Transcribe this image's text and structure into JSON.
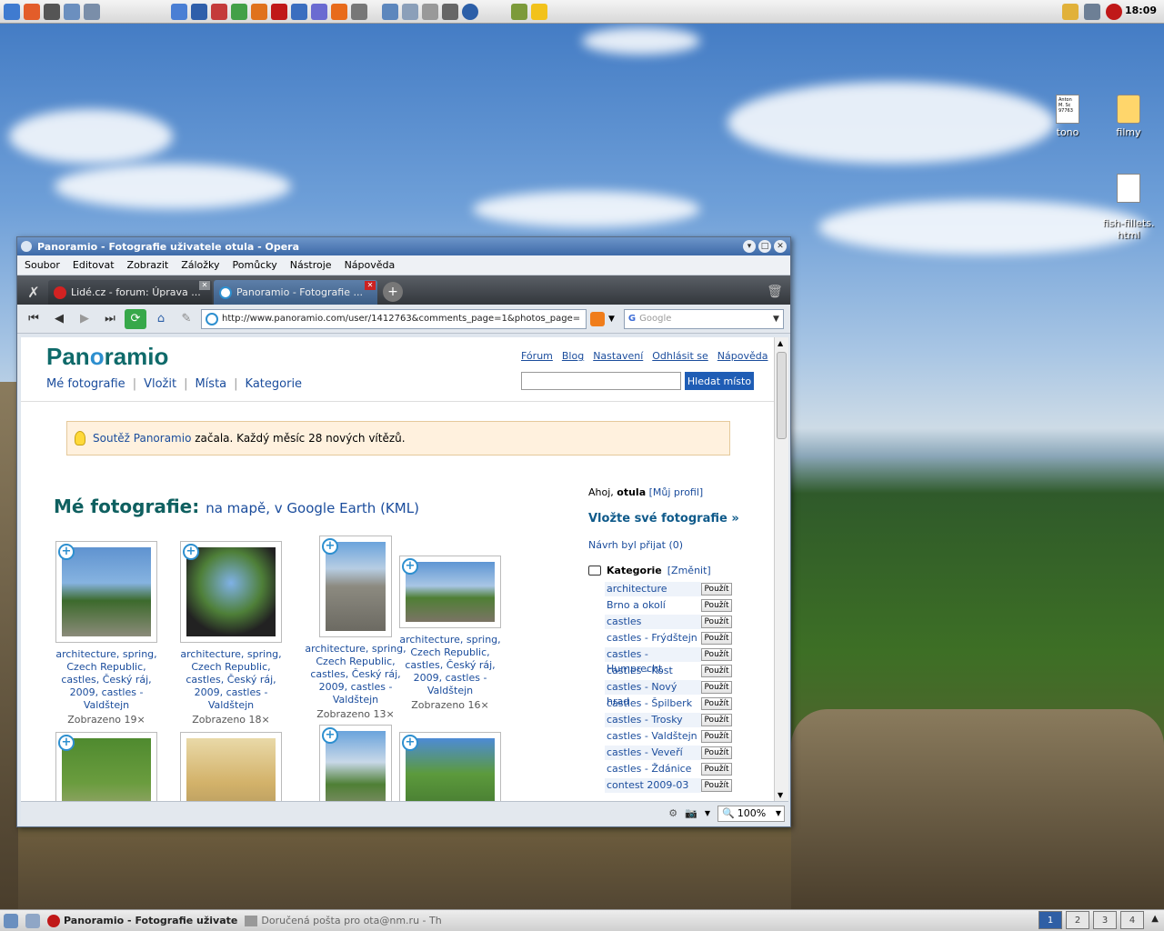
{
  "desktop": {
    "clock": "18:09",
    "icons": [
      {
        "label": "tono",
        "thumb_text": "Anton M. Sc 97763"
      },
      {
        "label": "filmy"
      },
      {
        "label": "fish-fillets.\nhtml"
      }
    ]
  },
  "window": {
    "title": "Panoramio - Fotografie uživatele otula - Opera",
    "menu": [
      "Soubor",
      "Editovat",
      "Zobrazit",
      "Záložky",
      "Pomůcky",
      "Nástroje",
      "Nápověda"
    ],
    "tabs": [
      {
        "label": "Lidé.cz - forum: Úprava ...",
        "active": false
      },
      {
        "label": "Panoramio - Fotografie ...",
        "active": true
      }
    ],
    "address": "http://www.panoramio.com/user/1412763&comments_page=1&photos_page=",
    "search_placeholder": "Google",
    "zoom": "100%"
  },
  "page": {
    "logo": {
      "pre": "Pan",
      "o": "o",
      "post": "ramio"
    },
    "nav": [
      "Mé fotografie",
      "Vložit",
      "Místa",
      "Kategorie"
    ],
    "toplinks": [
      "Fórum",
      "Blog",
      "Nastavení",
      "Odhlásit se",
      "Nápověda"
    ],
    "search_button": "Hledat místo",
    "notice": {
      "link": "Soutěž Panoramio",
      "text": " začala. Každý měsíc 28 nových vítězů."
    },
    "section_title": "Mé fotografie:",
    "section_links": {
      "map": "na mapě",
      "sep": ", ",
      "earth": "v Google Earth (KML)"
    },
    "photos": [
      {
        "tags": "architecture, spring, Czech Republic, castles, Český ráj, 2009, castles - Valdštejn",
        "views": "Zobrazeno 19×"
      },
      {
        "tags": "architecture, spring, Czech Republic, castles, Český ráj, 2009, castles - Valdštejn",
        "views": "Zobrazeno 18×"
      },
      {
        "tags": "architecture, spring, Czech Republic, castles, Český ráj, 2009, castles - Valdštejn",
        "views": "Zobrazeno 13×"
      },
      {
        "tags": "architecture, spring, Czech Republic, castles, Český ráj, 2009, castles - Valdštejn",
        "views": "Zobrazeno 16×"
      }
    ],
    "sidebar": {
      "hello": "Ahoj,",
      "user": "otula",
      "profile": "[Můj profil]",
      "upload": "Vložte své fotografie »",
      "accepted": "Návrh byl přijat (0)",
      "categories_title": "Kategorie",
      "categories_change": "[Změnit]",
      "use_label": "Použít",
      "categories": [
        "architecture",
        "Brno a okolí",
        "castles",
        "castles - Frýdštejn",
        "castles - Humprecht",
        "castles - Kost",
        "castles - Nový hrad",
        "castles - Špilberk",
        "castles - Trosky",
        "castles - Valdštejn",
        "castles - Veveří",
        "castles - Ždánice",
        "contest 2009-03"
      ]
    }
  },
  "taskbar": {
    "items": [
      "Panoramio - Fotografie uživate",
      "Doručená pošta pro ota@nm.ru - Th"
    ],
    "workspaces": [
      "1",
      "2",
      "3",
      "4"
    ]
  }
}
